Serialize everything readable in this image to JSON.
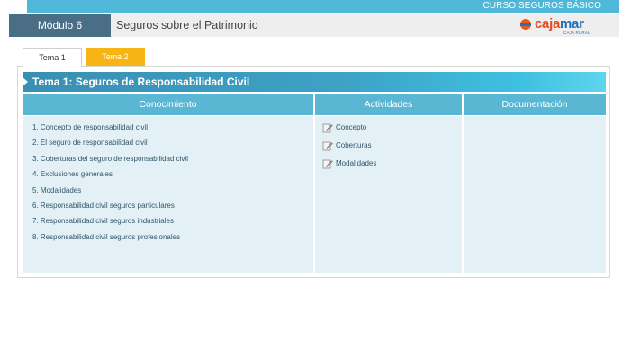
{
  "course": {
    "title": "CURSO SEGUROS BÁSICO"
  },
  "module": {
    "label": "Módulo 6",
    "title": "Seguros sobre el Patrimonio"
  },
  "brand": {
    "name_part1": "caja",
    "name_part2": "mar",
    "subtitle": "CAJA RURAL",
    "colors": {
      "red": "#e8491d",
      "blue": "#1f6fb8"
    }
  },
  "tabs": [
    {
      "label": "Tema 1",
      "active": true
    },
    {
      "label": "Tema 2",
      "active": false
    }
  ],
  "section": {
    "title": "Tema 1: Seguros de Responsabilidad Civil"
  },
  "columns": {
    "knowledge": "Conocimiento",
    "activities": "Actividades",
    "documentation": "Documentación"
  },
  "knowledge_items": [
    "1. Concepto de responsabilidad civil",
    "2. El seguro de responsabilidad civil",
    "3. Coberturas del seguro de responsabilidad civil",
    "4. Exclusiones generales",
    "5. Modalidades",
    "6. Responsabilidad civil seguros particulares",
    "7. Responsabilidad civil seguros industriales",
    "8. Responsabilidad civil seguros profesionales"
  ],
  "activities": [
    {
      "icon": "edit-icon",
      "label": "Concepto"
    },
    {
      "icon": "edit-icon",
      "label": "Coberturas"
    },
    {
      "icon": "edit-icon",
      "label": "Modalidades"
    }
  ],
  "theme_colors": {
    "accent": "#4fb8d9",
    "module_bg": "#4a6e85",
    "tab2": "#f7b514",
    "column_bg": "#e3f1f7"
  }
}
